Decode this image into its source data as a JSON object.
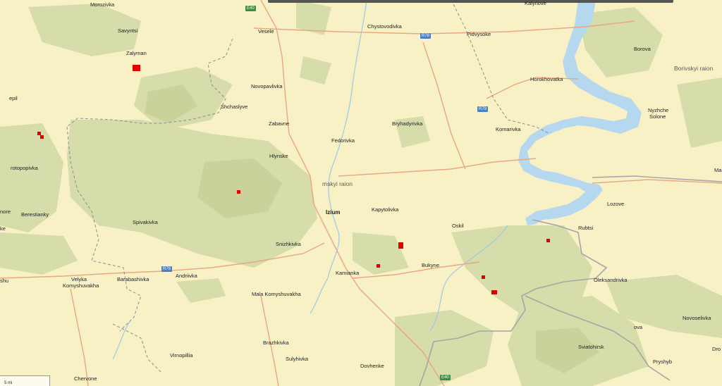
{
  "map": {
    "places": {
      "morozivka": "Morozivka",
      "savyntsi": "Savyntsi",
      "zalyman": "Zalyman",
      "vesele": "Vesele",
      "chystovodivka": "Chystovodivka",
      "pidvysoke": "Pidvysoke",
      "kalynove": "Kalynove",
      "borova": "Borova",
      "borivskyi_raion": "Borivskyi raion",
      "epil": "epil",
      "novopavlivka": "Novopavlivka",
      "horokhovatka": "Horokhovatka",
      "shchaslyve": "Shchaslyve",
      "nyzhche_solone_1": "Nyzhche",
      "nyzhche_solone_2": "Solone",
      "zabavne": "Zabavne",
      "bryhadyrivka": "Bryhadyrivka",
      "komarivka": "Komarivka",
      "fedorivka": "Fedorivka",
      "hlynske": "Hlynske",
      "rotopopivka": "rotopopivka",
      "ma": "Ma",
      "izium_raion": "mskyi raion",
      "lozove": "Lozove",
      "izium": "Izium",
      "kapytolivka": "Kapytolivka",
      "berestianky": "Berestianky",
      "spivakivka": "Spivakivka",
      "rubtsi": "Rubtsi",
      "oskil": "Oskil",
      "nore": "nore",
      "snizhkivka": "Snizhkivka",
      "bukyne": "Bukyne",
      "kamianka": "Kamianka",
      "andriivka": "Andriivka",
      "shu": "shu",
      "velyka_1": "Velyka",
      "velyka_2": "Komyshuvakha",
      "barabashivka": "Barabashivka",
      "oleksandrivka": "Oleksandrivka",
      "mala_komyshuvakha": "Mala Komyshuvakha",
      "novoselivka": "Novoselivka",
      "ova": "ova",
      "brazhkivka": "Brazhkivka",
      "sviatohirsk": "Sviatohirsk",
      "dro": "Dro",
      "virnopillia": "Virnopillia",
      "sulyhivka": "Sulyhivka",
      "pryshyb": "Pryshyb",
      "dovhenke": "Dovhenke",
      "chervone": "Chervone",
      "ke": "ke"
    },
    "shields": {
      "e40_top": "E40",
      "r78": "R78",
      "r79": "R79",
      "r79_west": "R79",
      "e40_bottom": "E40"
    },
    "scale_label": "5 mi",
    "colors": {
      "land": "#f8f1c6",
      "forest": "#d6dcaa",
      "forest_dark": "#c9d29b",
      "water": "#b5d8ee",
      "road": "#e6a882",
      "border": "#9a9a9a",
      "marker": "#e00000"
    }
  }
}
